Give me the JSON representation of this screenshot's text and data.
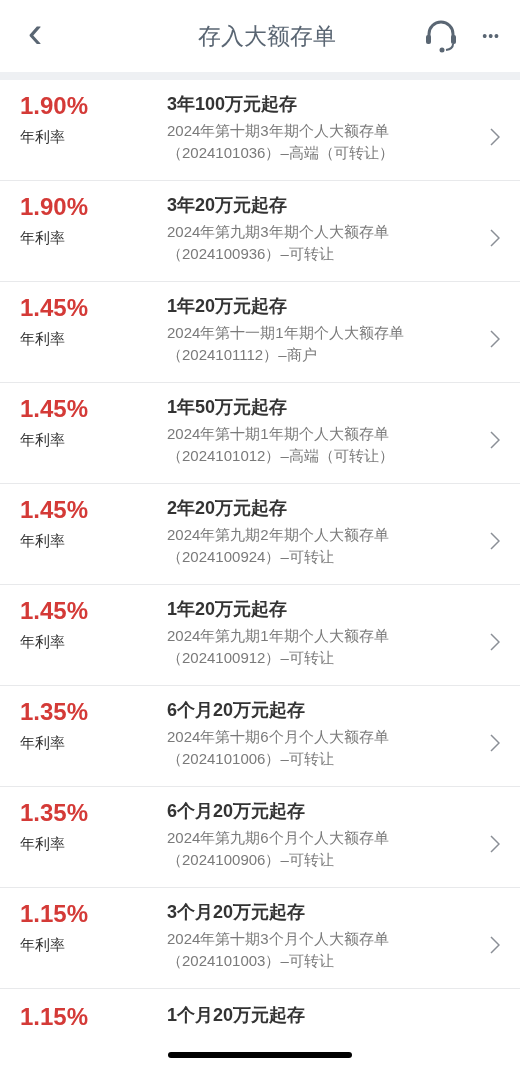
{
  "header": {
    "back": "‹",
    "title": "存入大额存单",
    "more": "•••"
  },
  "products": [
    {
      "rate": "1.90%",
      "rate_label": "年利率",
      "title": "3年100万元起存",
      "desc_lines": [
        "2024年第十期3年期个人大额存单",
        "（2024101036）–高端（可转让）"
      ]
    },
    {
      "rate": "1.90%",
      "rate_label": "年利率",
      "title": "3年20万元起存",
      "desc_lines": [
        "2024年第九期3年期个人大额存单",
        "（2024100936）–可转让"
      ]
    },
    {
      "rate": "1.45%",
      "rate_label": "年利率",
      "title": "1年20万元起存",
      "desc_lines": [
        "2024年第十一期1年期个人大额存单",
        "（2024101112）–商户"
      ]
    },
    {
      "rate": "1.45%",
      "rate_label": "年利率",
      "title": "1年50万元起存",
      "desc_lines": [
        "2024年第十期1年期个人大额存单",
        "（2024101012）–高端（可转让）"
      ]
    },
    {
      "rate": "1.45%",
      "rate_label": "年利率",
      "title": "2年20万元起存",
      "desc_lines": [
        "2024年第九期2年期个人大额存单",
        "（2024100924）–可转让"
      ]
    },
    {
      "rate": "1.45%",
      "rate_label": "年利率",
      "title": "1年20万元起存",
      "desc_lines": [
        "2024年第九期1年期个人大额存单",
        "（2024100912）–可转让"
      ]
    },
    {
      "rate": "1.35%",
      "rate_label": "年利率",
      "title": "6个月20万元起存",
      "desc_lines": [
        "2024年第十期6个月个人大额存单",
        "（2024101006）–可转让"
      ]
    },
    {
      "rate": "1.35%",
      "rate_label": "年利率",
      "title": "6个月20万元起存",
      "desc_lines": [
        "2024年第九期6个月个人大额存单",
        "（2024100906）–可转让"
      ]
    },
    {
      "rate": "1.15%",
      "rate_label": "年利率",
      "title": "3个月20万元起存",
      "desc_lines": [
        "2024年第十期3个月个人大额存单",
        "（2024101003）–可转让"
      ]
    },
    {
      "rate": "1.15%",
      "title": "1个月20万元起存"
    }
  ]
}
